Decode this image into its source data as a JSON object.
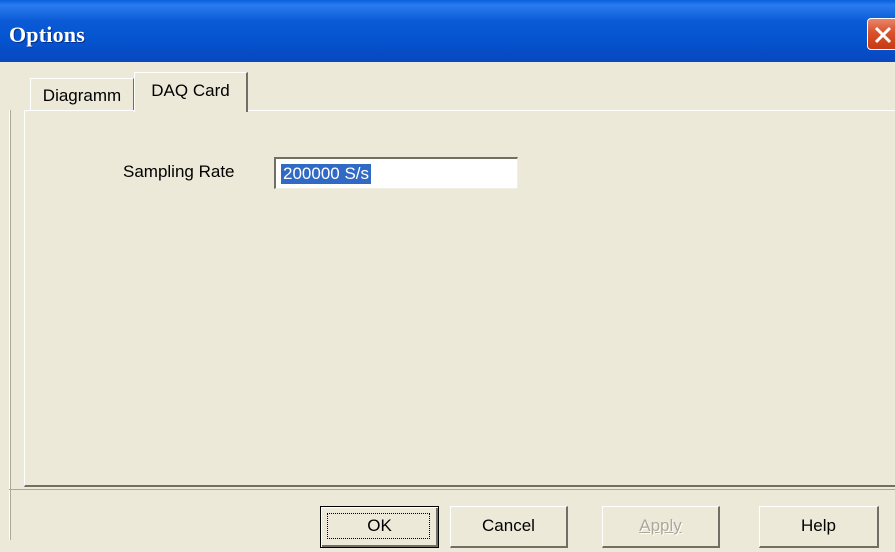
{
  "window": {
    "title": "Options"
  },
  "tabs": [
    {
      "label": "Diagramm",
      "selected": false
    },
    {
      "label": "DAQ Card",
      "selected": true
    }
  ],
  "daq_card": {
    "sampling_rate_label": "Sampling Rate",
    "sampling_rate_value": "200000 S/s"
  },
  "buttons": {
    "ok": "OK",
    "cancel": "Cancel",
    "apply": "Apply",
    "help": "Help"
  },
  "colors": {
    "titlebar": "#0A5AD6",
    "dialog_bg": "#ECE9D8",
    "selection": "#316AC5",
    "close": "#D9512C"
  },
  "icons": {
    "close": "close-icon"
  }
}
